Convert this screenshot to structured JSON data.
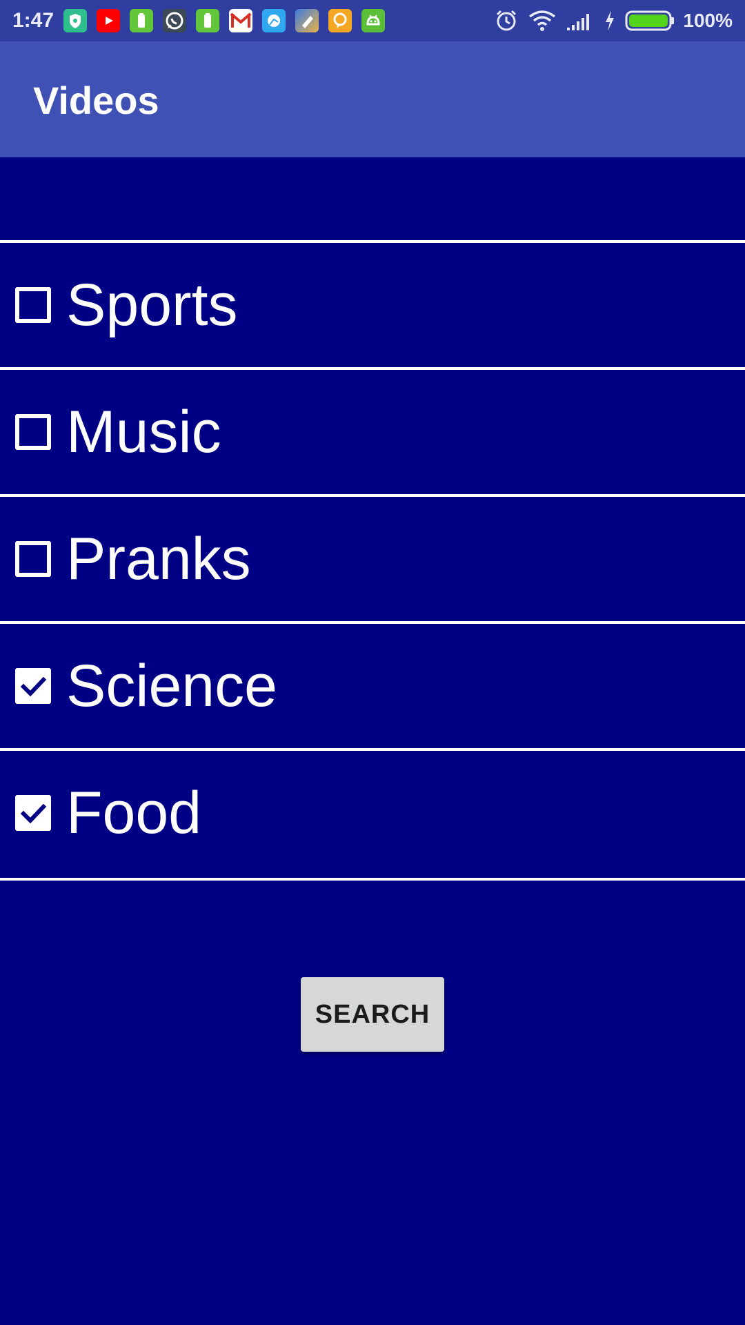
{
  "status_bar": {
    "time": "1:47",
    "battery_percent": "100%",
    "battery_level": 1.0,
    "notification_icons": [
      {
        "name": "shield-app-icon",
        "color": "#2fbf8f"
      },
      {
        "name": "youtube-icon",
        "color": "#ff0000"
      },
      {
        "name": "battery-app-icon",
        "color": "#63c53a"
      },
      {
        "name": "whatsapp-icon",
        "color": "#3c4a57"
      },
      {
        "name": "battery-app-icon",
        "color": "#63c53a"
      },
      {
        "name": "gmail-icon",
        "color": "#ffffff"
      },
      {
        "name": "messenger-icon",
        "color": "#2fa8f0"
      },
      {
        "name": "pencil-app-icon",
        "color": "#e8b34a"
      },
      {
        "name": "chat-bubble-app-icon",
        "color": "#f5a623"
      },
      {
        "name": "android-app-icon",
        "color": "#5bbf3a"
      }
    ],
    "system_icons": [
      "alarm-icon",
      "wifi-icon",
      "signal-icon",
      "charging-icon",
      "battery-icon"
    ]
  },
  "app_bar": {
    "title": "Videos",
    "color": "#3f51b5"
  },
  "categories": [
    {
      "label": "Sports",
      "checked": false
    },
    {
      "label": "Music",
      "checked": false
    },
    {
      "label": "Pranks",
      "checked": false
    },
    {
      "label": "Science",
      "checked": true
    },
    {
      "label": "Food",
      "checked": true
    }
  ],
  "search_button": {
    "label": "SEARCH"
  },
  "colors": {
    "background": "#000085",
    "status_bar": "#303f9f",
    "divider": "#ffffff",
    "button": "#d6d7d7"
  }
}
